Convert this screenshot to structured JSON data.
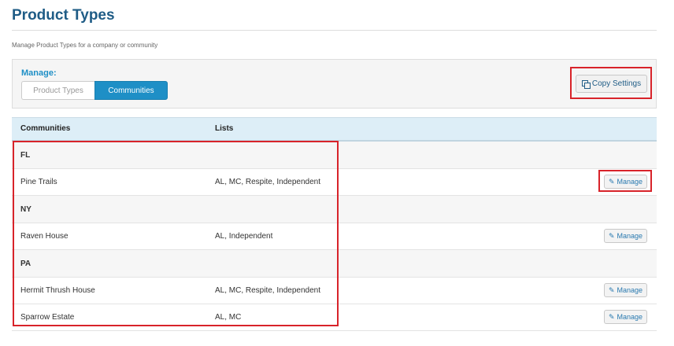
{
  "header": {
    "title": "Product Types",
    "subtitle": "Manage Product Types for a company or community"
  },
  "manage": {
    "label": "Manage:",
    "tabs": [
      {
        "label": "Product Types",
        "active": false
      },
      {
        "label": "Communities",
        "active": true
      }
    ],
    "copy_label": "Copy Settings"
  },
  "table": {
    "columns": [
      "Communities",
      "Lists"
    ],
    "groups": [
      {
        "name": "FL",
        "rows": [
          {
            "community": "Pine Trails",
            "lists": "AL, MC, Respite, Independent",
            "action": "Manage"
          }
        ]
      },
      {
        "name": "NY",
        "rows": [
          {
            "community": "Raven House",
            "lists": "AL, Independent",
            "action": "Manage"
          }
        ]
      },
      {
        "name": "PA",
        "rows": [
          {
            "community": "Hermit Thrush House",
            "lists": "AL, MC, Respite, Independent",
            "action": "Manage"
          },
          {
            "community": "Sparrow Estate",
            "lists": "AL, MC",
            "action": "Manage"
          }
        ]
      }
    ]
  },
  "colors": {
    "accent": "#1e8fc6",
    "title": "#1f5c86",
    "highlight": "#d8232a"
  }
}
